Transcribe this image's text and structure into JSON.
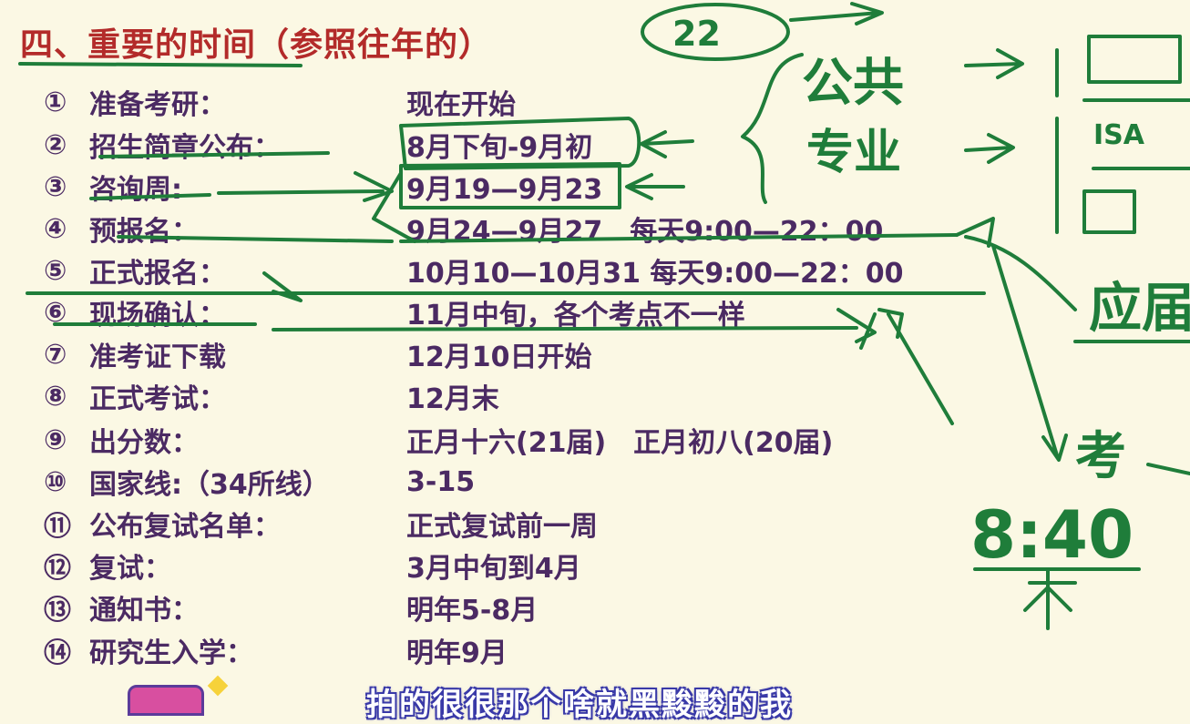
{
  "title": "四、重要的时间（参照往年的）",
  "rows": [
    {
      "num": "①",
      "label": "准备考研：",
      "value": "现在开始"
    },
    {
      "num": "②",
      "label": "招生简章公布：",
      "value": "8月下旬-9月初"
    },
    {
      "num": "③",
      "label": "咨询周:",
      "value": "9月19—9月23"
    },
    {
      "num": "④",
      "label": "预报名：",
      "value": "9月24—9月27　每天9:00—22：00"
    },
    {
      "num": "⑤",
      "label": "正式报名：",
      "value": "10月10—10月31  每天9:00—22：00"
    },
    {
      "num": "⑥",
      "label": "现场确认：",
      "value": "11月中旬，各个考点不一样"
    },
    {
      "num": "⑦",
      "label": "准考证下载",
      "value": "12月10日开始"
    },
    {
      "num": "⑧",
      "label": "正式考试：",
      "value": "12月末"
    },
    {
      "num": "⑨",
      "label": "出分数：",
      "value": "正月十六(21届)　正月初八(20届)"
    },
    {
      "num": "⑩",
      "label": "国家线:（34所线）",
      "value": "3-15"
    },
    {
      "num": "⑪",
      "label": "公布复试名单：",
      "value": "正式复试前一周"
    },
    {
      "num": "⑫",
      "label": "复试：",
      "value": "3月中旬到4月"
    },
    {
      "num": "⑬",
      "label": "通知书：",
      "value": "明年5-8月"
    },
    {
      "num": "⑭",
      "label": "研究生入学：",
      "value": "明年9月"
    }
  ],
  "handwriting": {
    "circled": "22",
    "line1": "公共",
    "line2": "专业",
    "time": "8:40",
    "right_frag": "考",
    "right_frag2": "应届"
  },
  "subtitle": "拍的很很那个啥就黑黢黢的我",
  "colors": {
    "background": "#fbf8e4",
    "title": "#b32b2a",
    "text": "#4b2a63",
    "ink": "#1f7d3a"
  }
}
